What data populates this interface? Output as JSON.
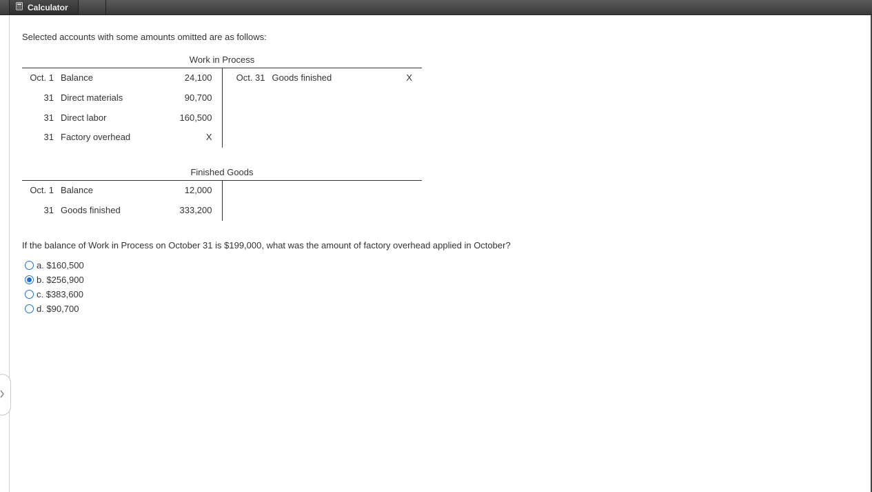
{
  "header": {
    "tab_label": "Calculator"
  },
  "intro": "Selected accounts with some amounts omitted are as follows:",
  "accounts": {
    "wip": {
      "title": "Work in Process",
      "debits": [
        {
          "date": "Oct. 1",
          "desc": "Balance",
          "amount": "24,100"
        },
        {
          "date": "31",
          "desc": "Direct materials",
          "amount": "90,700"
        },
        {
          "date": "31",
          "desc": "Direct labor",
          "amount": "160,500"
        },
        {
          "date": "31",
          "desc": "Factory overhead",
          "amount": "X"
        }
      ],
      "credits": [
        {
          "date": "Oct. 31",
          "desc": "Goods finished",
          "amount": "X"
        }
      ]
    },
    "fg": {
      "title": "Finished Goods",
      "debits": [
        {
          "date": "Oct. 1",
          "desc": "Balance",
          "amount": "12,000"
        },
        {
          "date": "31",
          "desc": "Goods finished",
          "amount": "333,200"
        }
      ],
      "credits": []
    }
  },
  "question": "If the balance of Work in Process on October 31 is $199,000, what was the amount of factory overhead applied in October?",
  "options": {
    "a": "a. $160,500",
    "b": "b. $256,900",
    "c": "c. $383,600",
    "d": "d. $90,700"
  },
  "selected": "b"
}
